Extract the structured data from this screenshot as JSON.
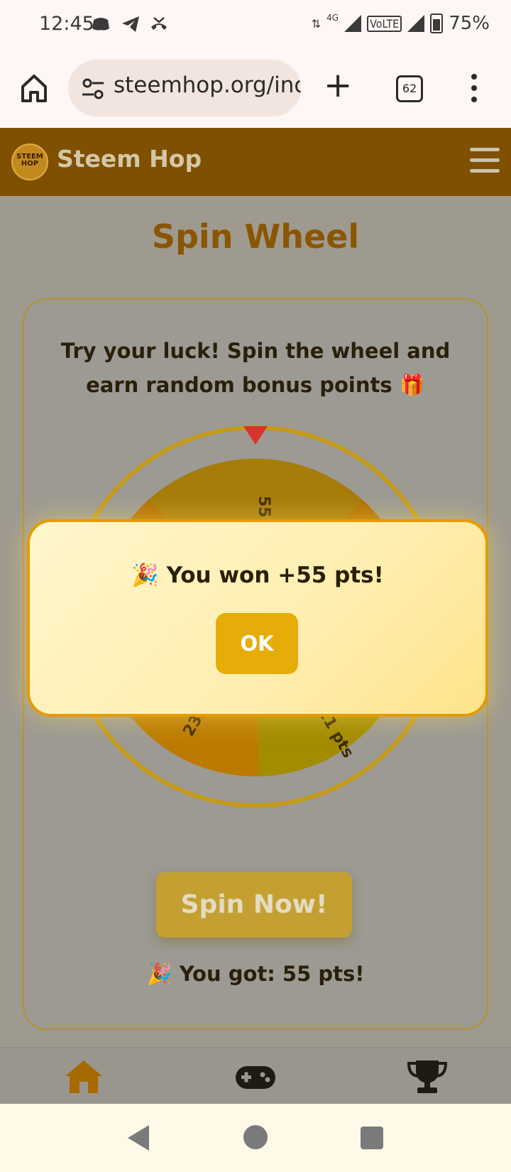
{
  "status_bar": {
    "time": "12:45",
    "network": "4G",
    "volte": "VoLTE",
    "battery": "75%"
  },
  "browser": {
    "url": "steemhop.org/inc",
    "tab_count": "62"
  },
  "header": {
    "brand": "Steem Hop",
    "logo_text": "STEEM HOP"
  },
  "page": {
    "title": "Spin Wheel",
    "intro": "Try your luck! Spin the wheel and earn random bonus points 🎁",
    "spin_button": "Spin Now!",
    "result": "🎉 You got: 55 pts!"
  },
  "wheel": {
    "segments": [
      {
        "label": "55 pts",
        "color": "#a67c0a"
      },
      {
        "label": "111 pts",
        "color": "#a38c00"
      },
      {
        "label": "233 pts",
        "color": "#bb7b00"
      }
    ],
    "pointer_color": "#d9342b",
    "rim_color": "#c59a18"
  },
  "dialog": {
    "message": "🎉 You won +55 pts!",
    "ok_label": "OK"
  },
  "bottom_nav": {
    "items": [
      "home-icon",
      "gamepad-icon",
      "trophy-icon"
    ],
    "active_color": "#a76a00"
  }
}
